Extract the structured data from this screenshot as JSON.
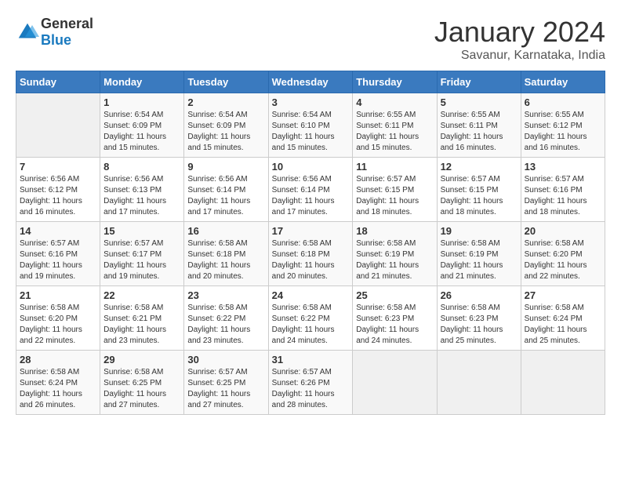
{
  "logo": {
    "text_general": "General",
    "text_blue": "Blue"
  },
  "header": {
    "month": "January 2024",
    "location": "Savanur, Karnataka, India"
  },
  "days_of_week": [
    "Sunday",
    "Monday",
    "Tuesday",
    "Wednesday",
    "Thursday",
    "Friday",
    "Saturday"
  ],
  "weeks": [
    [
      {
        "day": "",
        "sunrise": "",
        "sunset": "",
        "daylight": ""
      },
      {
        "day": "1",
        "sunrise": "Sunrise: 6:54 AM",
        "sunset": "Sunset: 6:09 PM",
        "daylight": "Daylight: 11 hours and 15 minutes."
      },
      {
        "day": "2",
        "sunrise": "Sunrise: 6:54 AM",
        "sunset": "Sunset: 6:09 PM",
        "daylight": "Daylight: 11 hours and 15 minutes."
      },
      {
        "day": "3",
        "sunrise": "Sunrise: 6:54 AM",
        "sunset": "Sunset: 6:10 PM",
        "daylight": "Daylight: 11 hours and 15 minutes."
      },
      {
        "day": "4",
        "sunrise": "Sunrise: 6:55 AM",
        "sunset": "Sunset: 6:11 PM",
        "daylight": "Daylight: 11 hours and 15 minutes."
      },
      {
        "day": "5",
        "sunrise": "Sunrise: 6:55 AM",
        "sunset": "Sunset: 6:11 PM",
        "daylight": "Daylight: 11 hours and 16 minutes."
      },
      {
        "day": "6",
        "sunrise": "Sunrise: 6:55 AM",
        "sunset": "Sunset: 6:12 PM",
        "daylight": "Daylight: 11 hours and 16 minutes."
      }
    ],
    [
      {
        "day": "7",
        "sunrise": "Sunrise: 6:56 AM",
        "sunset": "Sunset: 6:12 PM",
        "daylight": "Daylight: 11 hours and 16 minutes."
      },
      {
        "day": "8",
        "sunrise": "Sunrise: 6:56 AM",
        "sunset": "Sunset: 6:13 PM",
        "daylight": "Daylight: 11 hours and 17 minutes."
      },
      {
        "day": "9",
        "sunrise": "Sunrise: 6:56 AM",
        "sunset": "Sunset: 6:14 PM",
        "daylight": "Daylight: 11 hours and 17 minutes."
      },
      {
        "day": "10",
        "sunrise": "Sunrise: 6:56 AM",
        "sunset": "Sunset: 6:14 PM",
        "daylight": "Daylight: 11 hours and 17 minutes."
      },
      {
        "day": "11",
        "sunrise": "Sunrise: 6:57 AM",
        "sunset": "Sunset: 6:15 PM",
        "daylight": "Daylight: 11 hours and 18 minutes."
      },
      {
        "day": "12",
        "sunrise": "Sunrise: 6:57 AM",
        "sunset": "Sunset: 6:15 PM",
        "daylight": "Daylight: 11 hours and 18 minutes."
      },
      {
        "day": "13",
        "sunrise": "Sunrise: 6:57 AM",
        "sunset": "Sunset: 6:16 PM",
        "daylight": "Daylight: 11 hours and 18 minutes."
      }
    ],
    [
      {
        "day": "14",
        "sunrise": "Sunrise: 6:57 AM",
        "sunset": "Sunset: 6:16 PM",
        "daylight": "Daylight: 11 hours and 19 minutes."
      },
      {
        "day": "15",
        "sunrise": "Sunrise: 6:57 AM",
        "sunset": "Sunset: 6:17 PM",
        "daylight": "Daylight: 11 hours and 19 minutes."
      },
      {
        "day": "16",
        "sunrise": "Sunrise: 6:58 AM",
        "sunset": "Sunset: 6:18 PM",
        "daylight": "Daylight: 11 hours and 20 minutes."
      },
      {
        "day": "17",
        "sunrise": "Sunrise: 6:58 AM",
        "sunset": "Sunset: 6:18 PM",
        "daylight": "Daylight: 11 hours and 20 minutes."
      },
      {
        "day": "18",
        "sunrise": "Sunrise: 6:58 AM",
        "sunset": "Sunset: 6:19 PM",
        "daylight": "Daylight: 11 hours and 21 minutes."
      },
      {
        "day": "19",
        "sunrise": "Sunrise: 6:58 AM",
        "sunset": "Sunset: 6:19 PM",
        "daylight": "Daylight: 11 hours and 21 minutes."
      },
      {
        "day": "20",
        "sunrise": "Sunrise: 6:58 AM",
        "sunset": "Sunset: 6:20 PM",
        "daylight": "Daylight: 11 hours and 22 minutes."
      }
    ],
    [
      {
        "day": "21",
        "sunrise": "Sunrise: 6:58 AM",
        "sunset": "Sunset: 6:20 PM",
        "daylight": "Daylight: 11 hours and 22 minutes."
      },
      {
        "day": "22",
        "sunrise": "Sunrise: 6:58 AM",
        "sunset": "Sunset: 6:21 PM",
        "daylight": "Daylight: 11 hours and 23 minutes."
      },
      {
        "day": "23",
        "sunrise": "Sunrise: 6:58 AM",
        "sunset": "Sunset: 6:22 PM",
        "daylight": "Daylight: 11 hours and 23 minutes."
      },
      {
        "day": "24",
        "sunrise": "Sunrise: 6:58 AM",
        "sunset": "Sunset: 6:22 PM",
        "daylight": "Daylight: 11 hours and 24 minutes."
      },
      {
        "day": "25",
        "sunrise": "Sunrise: 6:58 AM",
        "sunset": "Sunset: 6:23 PM",
        "daylight": "Daylight: 11 hours and 24 minutes."
      },
      {
        "day": "26",
        "sunrise": "Sunrise: 6:58 AM",
        "sunset": "Sunset: 6:23 PM",
        "daylight": "Daylight: 11 hours and 25 minutes."
      },
      {
        "day": "27",
        "sunrise": "Sunrise: 6:58 AM",
        "sunset": "Sunset: 6:24 PM",
        "daylight": "Daylight: 11 hours and 25 minutes."
      }
    ],
    [
      {
        "day": "28",
        "sunrise": "Sunrise: 6:58 AM",
        "sunset": "Sunset: 6:24 PM",
        "daylight": "Daylight: 11 hours and 26 minutes."
      },
      {
        "day": "29",
        "sunrise": "Sunrise: 6:58 AM",
        "sunset": "Sunset: 6:25 PM",
        "daylight": "Daylight: 11 hours and 27 minutes."
      },
      {
        "day": "30",
        "sunrise": "Sunrise: 6:57 AM",
        "sunset": "Sunset: 6:25 PM",
        "daylight": "Daylight: 11 hours and 27 minutes."
      },
      {
        "day": "31",
        "sunrise": "Sunrise: 6:57 AM",
        "sunset": "Sunset: 6:26 PM",
        "daylight": "Daylight: 11 hours and 28 minutes."
      },
      {
        "day": "",
        "sunrise": "",
        "sunset": "",
        "daylight": ""
      },
      {
        "day": "",
        "sunrise": "",
        "sunset": "",
        "daylight": ""
      },
      {
        "day": "",
        "sunrise": "",
        "sunset": "",
        "daylight": ""
      }
    ]
  ]
}
